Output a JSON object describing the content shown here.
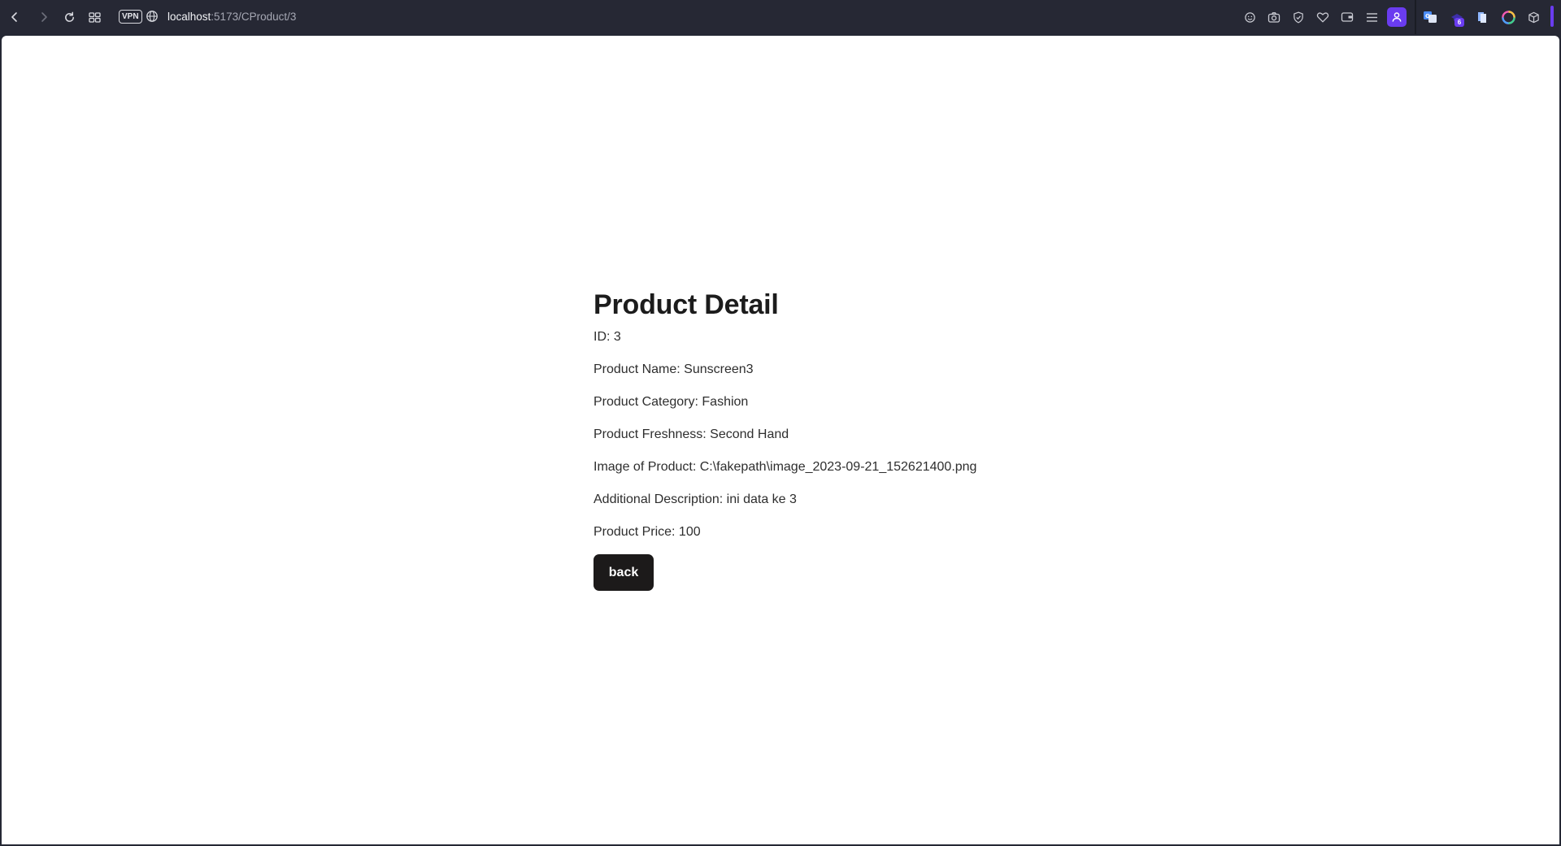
{
  "browser": {
    "vpn_label": "VPN",
    "url_host": "localhost",
    "url_path": ":5173/CProduct/3",
    "extension_badge": "6"
  },
  "page": {
    "title": "Product Detail",
    "fields": [
      {
        "label": "ID",
        "value": "3",
        "text": "ID: 3"
      },
      {
        "label": "Product Name",
        "value": "Sunscreen3",
        "text": "Product Name: Sunscreen3"
      },
      {
        "label": "Product Category",
        "value": "Fashion",
        "text": "Product Category: Fashion"
      },
      {
        "label": "Product Freshness",
        "value": "Second Hand",
        "text": "Product Freshness: Second Hand"
      },
      {
        "label": "Image of Product",
        "value": "C:\\fakepath\\image_2023-09-21_152621400.png",
        "text": "Image of Product: C:\\fakepath\\image_2023-09-21_152621400.png"
      },
      {
        "label": "Additional Description",
        "value": "ini data ke 3",
        "text": "Additional Description: ini data ke 3"
      },
      {
        "label": "Product Price",
        "value": "100",
        "text": "Product Price: 100"
      }
    ],
    "back_label": "back"
  },
  "colors": {
    "toolbar_bg": "#262834",
    "accent": "#6a3cf0",
    "button_bg": "#1c1a1a",
    "page_bg": "#ffffff"
  }
}
